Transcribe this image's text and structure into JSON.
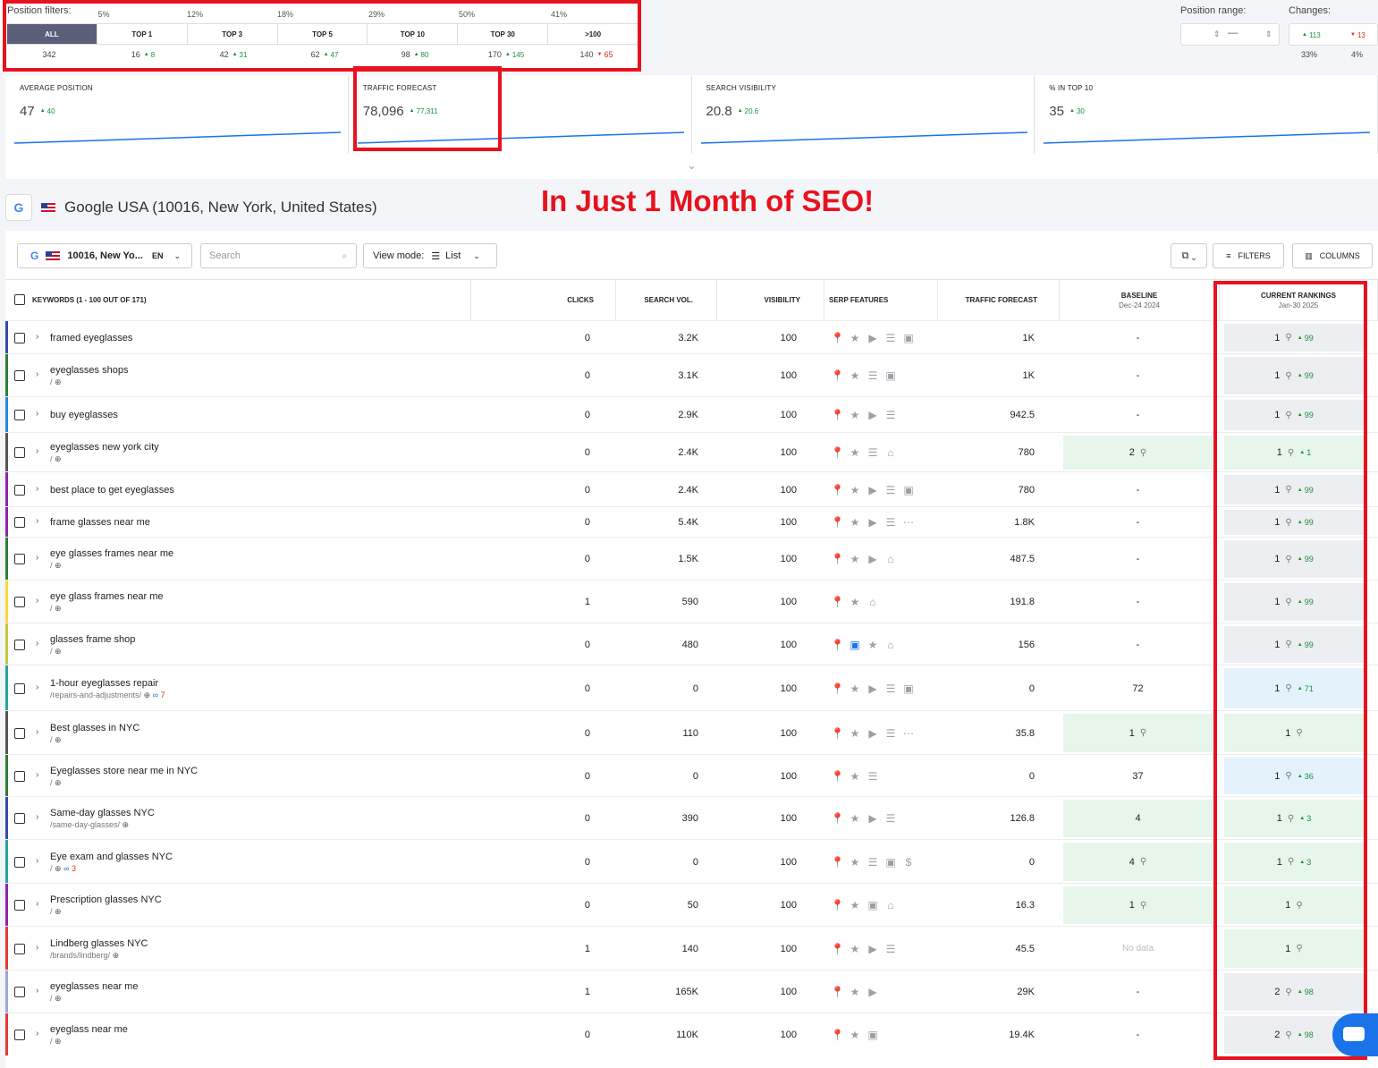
{
  "position_filters": {
    "label": "Position filters:",
    "percents": [
      "5%",
      "12%",
      "18%",
      "29%",
      "50%",
      "41%"
    ],
    "tabs": [
      "ALL",
      "TOP 1",
      "TOP 3",
      "TOP 5",
      "TOP 10",
      "TOP 30",
      ">100"
    ],
    "counts": [
      "342",
      "16",
      "42",
      "62",
      "98",
      "170",
      "140"
    ],
    "deltas": [
      "",
      "8",
      "31",
      "47",
      "80",
      "145",
      "65"
    ]
  },
  "position_range": {
    "label": "Position range:",
    "dash": "—"
  },
  "changes": {
    "label": "Changes:",
    "up": "113",
    "down": "13",
    "up_pct": "33%",
    "down_pct": "4%"
  },
  "metrics": [
    {
      "title": "AVERAGE POSITION",
      "value": "47",
      "delta": "40"
    },
    {
      "title": "TRAFFIC FORECAST",
      "value": "78,096",
      "delta": "77,311"
    },
    {
      "title": "SEARCH VISIBILITY",
      "value": "20.8",
      "delta": "20.6"
    },
    {
      "title": "% IN TOP 10",
      "value": "35",
      "delta": "30"
    }
  ],
  "engine": {
    "badge": "G",
    "title": "Google USA (10016, New York, United States)"
  },
  "headline": "In Just 1 Month of SEO!",
  "toolbar": {
    "location": "10016, New Yo...",
    "lang": "EN",
    "search_placeholder": "Search",
    "view_mode_label": "View mode:",
    "view_mode_value": "List",
    "filters": "FILTERS",
    "columns": "COLUMNS"
  },
  "table": {
    "headers": {
      "keywords": "KEYWORDS (1 - 100 OUT OF 171)",
      "clicks": "CLICKS",
      "search_vol": "SEARCH VOL.",
      "visibility": "VISIBILITY",
      "serp": "SERP FEATURES",
      "traffic": "TRAFFIC FORECAST",
      "baseline": "BASELINE",
      "baseline_date": "Dec-24 2024",
      "current": "CURRENT RANKINGS",
      "current_date": "Jan-30 2025"
    },
    "rows": [
      {
        "kw": "framed eyeglasses",
        "sub": "",
        "clicks": "0",
        "vol": "3.2K",
        "vis": "100",
        "serp": [
          "pin",
          "star",
          "video",
          "list",
          "image"
        ],
        "traffic": "1K",
        "base": "-",
        "base_pin": false,
        "base_style": "",
        "rank": "1",
        "rank_delta": "99",
        "rank_style": "",
        "color": "#3949ab"
      },
      {
        "kw": "eyeglasses shops",
        "sub": "/",
        "clicks": "0",
        "vol": "3.1K",
        "vis": "100",
        "serp": [
          "pin",
          "star",
          "list",
          "image"
        ],
        "traffic": "1K",
        "base": "-",
        "base_pin": false,
        "base_style": "",
        "rank": "1",
        "rank_delta": "99",
        "rank_style": "",
        "color": "#2e7d32"
      },
      {
        "kw": "buy eyeglasses",
        "sub": "",
        "clicks": "0",
        "vol": "2.9K",
        "vis": "100",
        "serp": [
          "pin",
          "star",
          "video",
          "list"
        ],
        "traffic": "942.5",
        "base": "-",
        "base_pin": false,
        "base_style": "",
        "rank": "1",
        "rank_delta": "99",
        "rank_style": "",
        "color": "#1e88e5"
      },
      {
        "kw": "eyeglasses new york city",
        "sub": "/",
        "clicks": "0",
        "vol": "2.4K",
        "vis": "100",
        "serp": [
          "pin",
          "star",
          "list",
          "shop"
        ],
        "traffic": "780",
        "base": "2",
        "base_pin": true,
        "base_style": "green",
        "rank": "1",
        "rank_delta": "1",
        "rank_style": "green",
        "color": "#555"
      },
      {
        "kw": "best place to get eyeglasses",
        "sub": "",
        "clicks": "0",
        "vol": "2.4K",
        "vis": "100",
        "serp": [
          "pin",
          "star",
          "video",
          "list",
          "image"
        ],
        "traffic": "780",
        "base": "-",
        "base_pin": false,
        "base_style": "",
        "rank": "1",
        "rank_delta": "99",
        "rank_style": "",
        "color": "#8e24aa"
      },
      {
        "kw": "frame glasses near me",
        "sub": "",
        "clicks": "0",
        "vol": "5.4K",
        "vis": "100",
        "serp": [
          "pin",
          "star",
          "video",
          "list",
          "more"
        ],
        "traffic": "1.8K",
        "base": "-",
        "base_pin": false,
        "base_style": "",
        "rank": "1",
        "rank_delta": "99",
        "rank_style": "",
        "color": "#8e24aa"
      },
      {
        "kw": "eye glasses frames near me",
        "sub": "/",
        "clicks": "0",
        "vol": "1.5K",
        "vis": "100",
        "serp": [
          "pin",
          "star",
          "video",
          "shop"
        ],
        "traffic": "487.5",
        "base": "-",
        "base_pin": false,
        "base_style": "",
        "rank": "1",
        "rank_delta": "99",
        "rank_style": "",
        "color": "#2e7d32"
      },
      {
        "kw": "eye glass frames near me",
        "sub": "/",
        "clicks": "1",
        "vol": "590",
        "vis": "100",
        "serp": [
          "pin",
          "star",
          "shop"
        ],
        "traffic": "191.8",
        "base": "-",
        "base_pin": false,
        "base_style": "",
        "rank": "1",
        "rank_delta": "99",
        "rank_style": "",
        "color": "#fdd835"
      },
      {
        "kw": "glasses frame shop",
        "sub": "/",
        "clicks": "0",
        "vol": "480",
        "vis": "100",
        "serp": [
          "pin",
          "imageblue",
          "star",
          "shop"
        ],
        "traffic": "156",
        "base": "-",
        "base_pin": false,
        "base_style": "",
        "rank": "1",
        "rank_delta": "99",
        "rank_style": "",
        "color": "#c0ca33"
      },
      {
        "kw": "1-hour eyeglasses repair",
        "sub": "/repairs-and-adjustments/",
        "sub_count": "7",
        "clicks": "0",
        "vol": "0",
        "vis": "100",
        "serp": [
          "pin",
          "star",
          "video",
          "list",
          "image"
        ],
        "traffic": "0",
        "base": "72",
        "base_pin": false,
        "base_style": "",
        "rank": "1",
        "rank_delta": "71",
        "rank_style": "blue",
        "color": "#26a69a"
      },
      {
        "kw": "Best glasses in NYC",
        "sub": "/",
        "clicks": "0",
        "vol": "110",
        "vis": "100",
        "serp": [
          "pin",
          "star",
          "video",
          "list",
          "more"
        ],
        "traffic": "35.8",
        "base": "1",
        "base_pin": true,
        "base_style": "green",
        "rank": "1",
        "rank_delta": "",
        "rank_style": "green",
        "color": "#555"
      },
      {
        "kw": "Eyeglasses store near me in NYC",
        "sub": "/",
        "clicks": "0",
        "vol": "0",
        "vis": "100",
        "serp": [
          "pin",
          "star",
          "list"
        ],
        "traffic": "0",
        "base": "37",
        "base_pin": false,
        "base_style": "",
        "rank": "1",
        "rank_delta": "36",
        "rank_style": "blue",
        "color": "#2e7d32"
      },
      {
        "kw": "Same-day glasses NYC",
        "sub": "/same-day-glasses/",
        "clicks": "0",
        "vol": "390",
        "vis": "100",
        "serp": [
          "pin",
          "star",
          "video",
          "list"
        ],
        "traffic": "126.8",
        "base": "4",
        "base_pin": false,
        "base_style": "green",
        "rank": "1",
        "rank_delta": "3",
        "rank_style": "green",
        "color": "#3949ab"
      },
      {
        "kw": "Eye exam and glasses NYC",
        "sub": "/",
        "sub_count": "3",
        "clicks": "0",
        "vol": "0",
        "vis": "100",
        "serp": [
          "pin",
          "star",
          "list",
          "image",
          "coin"
        ],
        "traffic": "0",
        "base": "4",
        "base_pin": true,
        "base_style": "green",
        "rank": "1",
        "rank_delta": "3",
        "rank_style": "green",
        "color": "#26a69a"
      },
      {
        "kw": "Prescription glasses NYC",
        "sub": "/",
        "clicks": "0",
        "vol": "50",
        "vis": "100",
        "serp": [
          "pin",
          "star",
          "image",
          "shop"
        ],
        "traffic": "16.3",
        "base": "1",
        "base_pin": true,
        "base_style": "green",
        "rank": "1",
        "rank_delta": "",
        "rank_style": "green",
        "color": "#8e24aa"
      },
      {
        "kw": "Lindberg glasses NYC",
        "sub": "/brands/lindberg/",
        "clicks": "1",
        "vol": "140",
        "vis": "100",
        "serp": [
          "pin",
          "star",
          "video",
          "list"
        ],
        "traffic": "45.5",
        "base": "No data",
        "base_pin": false,
        "base_style": "nodata",
        "rank": "1",
        "rank_delta": "",
        "rank_style": "green",
        "color": "#e53935"
      },
      {
        "kw": "eyeglasses near me",
        "sub": "/",
        "clicks": "1",
        "vol": "165K",
        "vis": "100",
        "serp": [
          "pin",
          "star",
          "video"
        ],
        "traffic": "29K",
        "base": "-",
        "base_pin": false,
        "base_style": "",
        "rank": "2",
        "rank_delta": "98",
        "rank_style": "",
        "color": "#9fa8da"
      },
      {
        "kw": "eyeglass near me",
        "sub": "/",
        "clicks": "0",
        "vol": "110K",
        "vis": "100",
        "serp": [
          "pin",
          "star",
          "image"
        ],
        "traffic": "19.4K",
        "base": "-",
        "base_pin": false,
        "base_style": "",
        "rank": "2",
        "rank_delta": "98",
        "rank_style": "",
        "color": "#e53935"
      }
    ]
  },
  "colors": {
    "accent": "#1a73e8",
    "highlight": "#e8121e",
    "up": "#1e8e3e",
    "down": "#d93025"
  }
}
